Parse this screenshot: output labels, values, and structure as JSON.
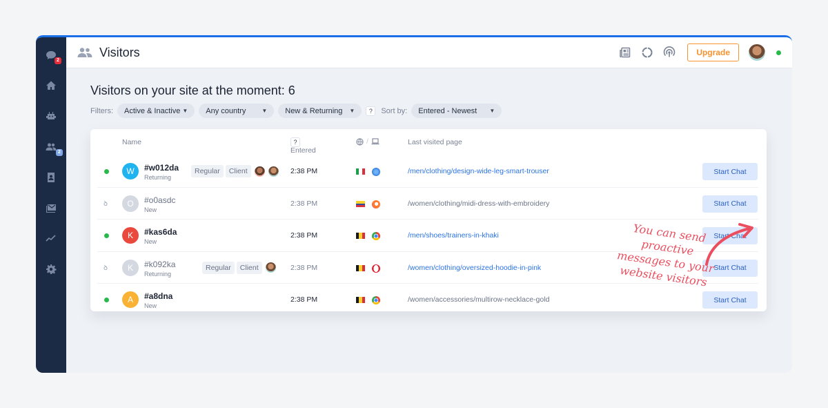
{
  "app": {
    "title": "Visitors",
    "upgrade_label": "Upgrade",
    "accent_color": "#1a6fe8",
    "upgrade_color": "#f7922f"
  },
  "sidebar": {
    "items": [
      {
        "name": "chats",
        "icon": "chat-bubble-icon",
        "badge": "2",
        "badge_color": "#e52d3c"
      },
      {
        "name": "home",
        "icon": "home-icon"
      },
      {
        "name": "bots",
        "icon": "bot-icon"
      },
      {
        "name": "visitors",
        "icon": "users-icon",
        "badge": "2",
        "badge_color": "#7fa6e6"
      },
      {
        "name": "contacts",
        "icon": "contact-card-icon"
      },
      {
        "name": "inbox",
        "icon": "inbox-icon"
      },
      {
        "name": "analytics",
        "icon": "trend-line-icon"
      },
      {
        "name": "settings",
        "icon": "gear-icon"
      }
    ]
  },
  "topbar": {
    "icons": [
      "newspaper-icon",
      "loading-ring-icon",
      "broadcast-icon"
    ]
  },
  "main": {
    "headline": "Visitors on your site at the moment: 6",
    "filters_label": "Filters:",
    "filters": [
      {
        "label": "Active & Inactive"
      },
      {
        "label": "Any country"
      },
      {
        "label": "New & Returning"
      }
    ],
    "help_label": "?",
    "sort_label": "Sort by:",
    "sort_value": "Entered - Newest"
  },
  "table": {
    "headers": {
      "name": "Name",
      "entered": "Entered",
      "entered_help": "?",
      "location_device": "/",
      "last_page": "Last visited page"
    },
    "rows": [
      {
        "status": "active",
        "initial": "W",
        "avatar_color": "#1fb4f0",
        "name": "#w012da",
        "type": "Returning",
        "tags": [
          "Regular",
          "Client"
        ],
        "agents": 2,
        "entered": "2:38 PM",
        "country": "Italy",
        "browser": "Safari",
        "page": "/men/clothing/design-wide-leg-smart-trouser",
        "page_linked": true,
        "action": "Start Chat"
      },
      {
        "status": "idle",
        "initial": "O",
        "avatar_color": "#d3d8e1",
        "name": "#o0asdc",
        "type": "New",
        "tags": [],
        "agents": 0,
        "entered": "2:38 PM",
        "country": "Colombia",
        "browser": "Firefox",
        "page": "/women/clothing/midi-dress-with-embroidery",
        "page_linked": false,
        "action": "Start Chat"
      },
      {
        "status": "active",
        "initial": "K",
        "avatar_color": "#ea4a3e",
        "name": "#kas6da",
        "type": "New",
        "tags": [],
        "agents": 0,
        "entered": "2:38 PM",
        "country": "Belgium",
        "browser": "Chrome",
        "page": "/men/shoes/trainers-in-khaki",
        "page_linked": true,
        "action": "Start Chat"
      },
      {
        "status": "idle",
        "initial": "K",
        "avatar_color": "#d3d8e1",
        "name": "#k092ka",
        "type": "Returning",
        "tags": [
          "Regular",
          "Client"
        ],
        "agents": 1,
        "entered": "2:38 PM",
        "country": "Belgium",
        "browser": "Opera",
        "page": "/women/clothing/oversized-hoodie-in-pink",
        "page_linked": true,
        "action": "Start Chat"
      },
      {
        "status": "active",
        "initial": "A",
        "avatar_color": "#f9b233",
        "name": "#a8dna",
        "type": "New",
        "tags": [],
        "agents": 0,
        "entered": "2:38 PM",
        "country": "Belgium",
        "browser": "Chrome",
        "page": "/women/accessories/multirow-necklace-gold",
        "page_linked": false,
        "action": "Start Chat"
      }
    ]
  },
  "annotation": {
    "text": "You can send proactive messages to your website visitors",
    "color": "#ea4f5f"
  }
}
